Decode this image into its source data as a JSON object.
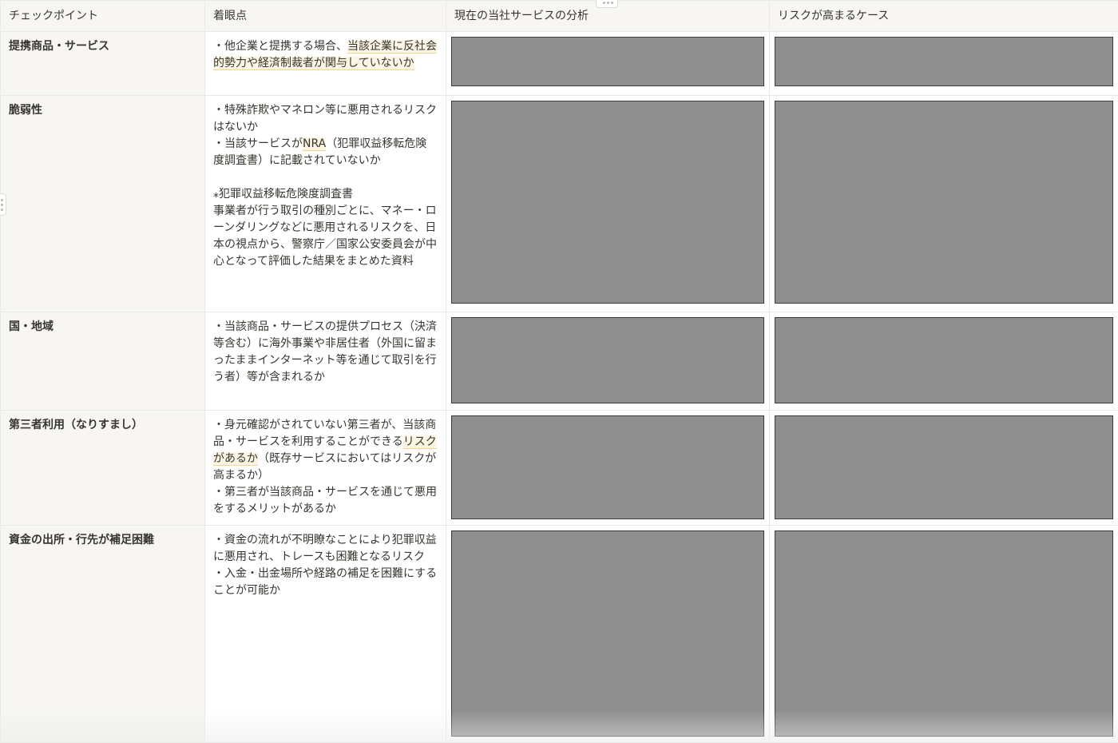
{
  "headers": {
    "col1": "チェックポイント",
    "col2": "着眼点",
    "col3": "現在の当社サービスの分析",
    "col4": "リスクが高まるケース"
  },
  "rows": [
    {
      "checkpoint": "提携商品・サービス",
      "focus_a": "・他企業と提携する場合、",
      "focus_hl": "当該企業に反社会的勢力や経済制裁者が関与していないか",
      "focus_b": ""
    },
    {
      "checkpoint": "脆弱性",
      "focus_a": "・特殊詐欺やマネロン等に悪用されるリスクはないか\n・当該サービスが",
      "focus_hl": "NRA",
      "focus_b": "（犯罪収益移転危険度調査書）に記載されていないか\n\n⁎犯罪収益移転危険度調査書\n事業者が行う取引の種別ごとに、マネー・ローンダリングなどに悪用されるリスクを、日本の視点から、警察庁／国家公安委員会が中心となって評価した結果をまとめた資料"
    },
    {
      "checkpoint": "国・地域",
      "focus_a": "・当該商品・サービスの提供プロセス（決済等含む）に海外事業や非居住者（外国に留まったままインターネット等を通じて取引を行う者）等が含まれるか",
      "focus_hl": "",
      "focus_b": ""
    },
    {
      "checkpoint": "第三者利用（なりすまし）",
      "focus_a": "・身元確認がされていない第三者が、当該商品・サービスを利用することができる",
      "focus_hl": "リスクがあるか",
      "focus_b": "（既存サービスにおいてはリスクが高まるか）\n・第三者が当該商品・サービスを通じて悪用をするメリットがあるか"
    },
    {
      "checkpoint": "資金の出所・行先が補足困難",
      "focus_a": "・資金の流れが不明瞭なことにより犯罪収益に悪用され、トレースも困難となるリスク\n・入金・出金場所や経路の補足を困難にすることが可能か",
      "focus_hl": "",
      "focus_b": ""
    }
  ]
}
